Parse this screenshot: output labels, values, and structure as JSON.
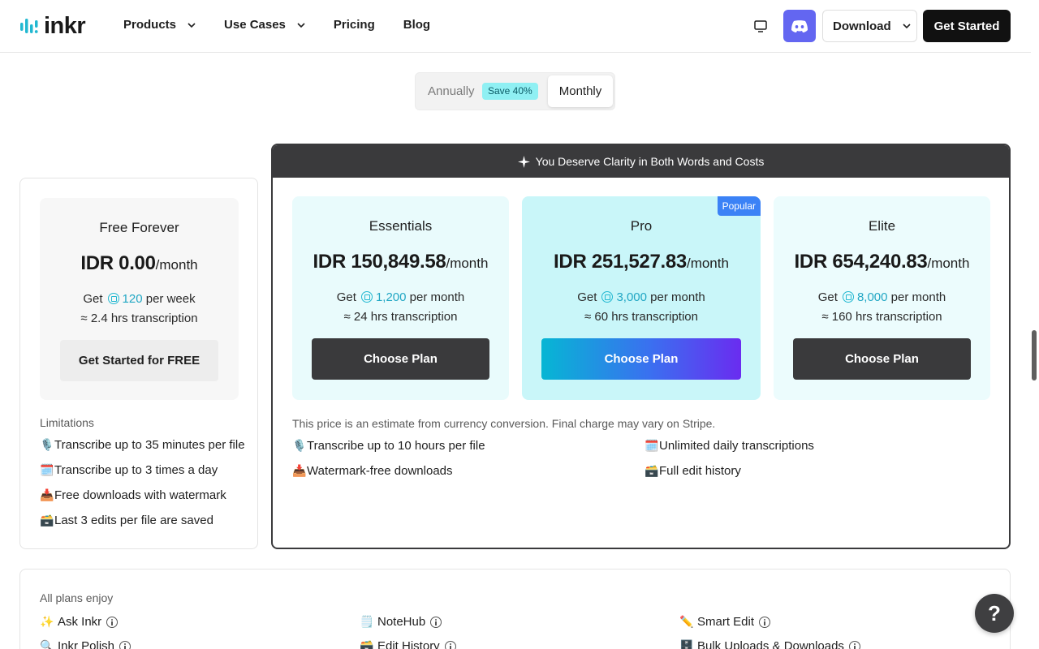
{
  "header": {
    "logo_text": "inkr",
    "nav": [
      {
        "label": "Products",
        "has_dropdown": true
      },
      {
        "label": "Use Cases",
        "has_dropdown": true
      },
      {
        "label": "Pricing",
        "has_dropdown": false
      },
      {
        "label": "Blog",
        "has_dropdown": false
      }
    ],
    "download_label": "Download",
    "get_started_label": "Get Started",
    "icons": [
      "monitor-icon",
      "discord-icon",
      "chevron-down-icon"
    ],
    "discord_color": "#6366f1"
  },
  "billing_toggle": {
    "annually_label": "Annually",
    "save_badge": "Save 40%",
    "monthly_label": "Monthly",
    "selected": "Monthly"
  },
  "free_plan": {
    "name": "Free Forever",
    "price": "IDR 0.00",
    "period": "/month",
    "credits_prefix": "Get",
    "credits": "120",
    "credits_suffix": "per week",
    "hours": "≈ 2.4 hrs transcription",
    "cta": "Get Started for FREE",
    "limitations_title": "Limitations",
    "limitations": [
      {
        "icon": "🎙️",
        "text": "Transcribe up to 35 minutes per file"
      },
      {
        "icon": "🗓️",
        "text": " Transcribe up to 3 times a day"
      },
      {
        "icon": "📥",
        "text": "Free downloads with watermark"
      },
      {
        "icon": "🗃️",
        "text": "Last 3 edits per file are saved"
      }
    ]
  },
  "paid": {
    "banner": "You Deserve Clarity in Both Words and Costs",
    "plans": [
      {
        "name": "Essentials",
        "price": "IDR 150,849.58",
        "period": "/month",
        "credits_prefix": "Get",
        "credits": "1,200",
        "credits_suffix": "per month",
        "hours": "≈ 24 hrs transcription",
        "cta": "Choose Plan"
      },
      {
        "name": "Pro",
        "badge": "Popular",
        "price": "IDR 251,527.83",
        "period": "/month",
        "credits_prefix": "Get",
        "credits": "3,000",
        "credits_suffix": "per month",
        "hours": "≈ 60 hrs transcription",
        "cta": "Choose Plan"
      },
      {
        "name": "Elite",
        "price": "IDR 654,240.83",
        "period": "/month",
        "credits_prefix": "Get",
        "credits": "8,000",
        "credits_suffix": "per month",
        "hours": "≈ 160 hrs transcription",
        "cta": "Choose Plan"
      }
    ],
    "disclaimer": "This price is an estimate from currency conversion. Final charge may vary on Stripe.",
    "features": [
      {
        "icon": "🎙️",
        "text": "Transcribe up to 10 hours per file"
      },
      {
        "icon": "🗓️",
        "text": " Unlimited daily transcriptions"
      },
      {
        "icon": "📥",
        "text": "Watermark-free downloads"
      },
      {
        "icon": "🗃️",
        "text": "Full edit history"
      }
    ]
  },
  "all_plans": {
    "title": "All plans enjoy",
    "items": [
      {
        "icon": "✨",
        "text": "Ask Inkr"
      },
      {
        "icon": "🗒️",
        "text": "NoteHub"
      },
      {
        "icon": "✏️",
        "text": "Smart Edit"
      },
      {
        "icon": "🔍",
        "text": "Inkr Polish"
      },
      {
        "icon": "🗃️",
        "text": "Edit History"
      },
      {
        "icon": "🗄️",
        "text": "Bulk Uploads & Downloads"
      }
    ]
  },
  "help_label": "?"
}
